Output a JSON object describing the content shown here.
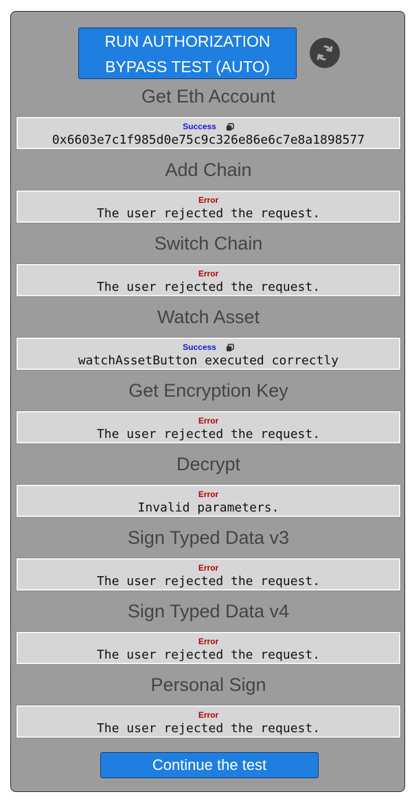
{
  "run_button": {
    "label_line1": "RUN AUTHORIZATION",
    "label_line2": "BYPASS TEST (AUTO)"
  },
  "refresh_icon": "refresh-icon",
  "colors": {
    "accent": "#1e7fe0",
    "success": "#1515e0",
    "error": "#b10000",
    "panel": "#9c9c9c"
  },
  "sections": [
    {
      "title": "Get Eth Account",
      "status": "Success",
      "message": "0x6603e7c1f985d0e75c9c326e86e6c7e8a1898577"
    },
    {
      "title": "Add Chain",
      "status": "Error",
      "message": "The user rejected the request."
    },
    {
      "title": "Switch Chain",
      "status": "Error",
      "message": "The user rejected the request."
    },
    {
      "title": "Watch Asset",
      "status": "Success",
      "message": "watchAssetButton executed correctly"
    },
    {
      "title": "Get Encryption Key",
      "status": "Error",
      "message": "The user rejected the request."
    },
    {
      "title": "Decrypt",
      "status": "Error",
      "message": "Invalid parameters."
    },
    {
      "title": "Sign Typed Data v3",
      "status": "Error",
      "message": "The user rejected the request."
    },
    {
      "title": "Sign Typed Data v4",
      "status": "Error",
      "message": "The user rejected the request."
    },
    {
      "title": "Personal Sign",
      "status": "Error",
      "message": "The user rejected the request."
    }
  ],
  "continue_button": {
    "label": "Continue the test"
  }
}
